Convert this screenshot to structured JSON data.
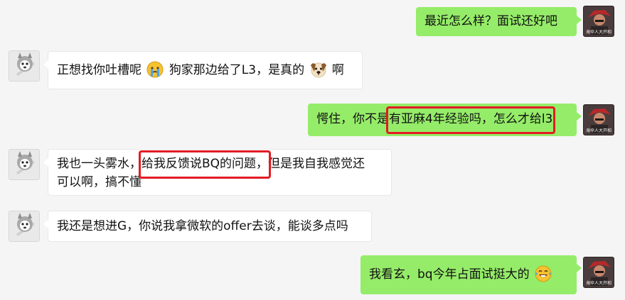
{
  "messages": [
    {
      "side": "right",
      "avatar": "avatar-red-hair",
      "text": "最近怎么样？面试还好吧"
    },
    {
      "side": "left",
      "avatar": "avatar-husky",
      "part1": "正想找你吐槽呢",
      "emoji1": "crying-face-icon",
      "part2": "狗家那边给了L3，是真的",
      "emoji2": "dog-face-icon",
      "part3": "啊"
    },
    {
      "side": "right",
      "avatar": "avatar-red-hair",
      "part1": "愕住，你不是",
      "highlight": "有亚麻4年经验吗，怎么才给l3"
    },
    {
      "side": "left",
      "avatar": "avatar-husky",
      "part1": "我也一头雾水，",
      "highlight": "给我反馈说BQ的问题，",
      "part2": "但是我自我感觉还",
      "part3": "可以啊，搞不懂"
    },
    {
      "side": "left",
      "avatar": "avatar-husky",
      "text": "我还是想进G，你说我拿微软的offer去谈，能谈多点吗"
    },
    {
      "side": "right",
      "avatar": "avatar-red-hair",
      "text": "我看玄，bq今年占面试挺大的",
      "emoji": "tears-of-joy-icon"
    }
  ],
  "avatar_caption": "海伞人大开和",
  "colors": {
    "background": "#f5f5f5",
    "self_bubble": "#95ec69",
    "other_bubble": "#ffffff",
    "highlight_box": "#e31b23"
  }
}
